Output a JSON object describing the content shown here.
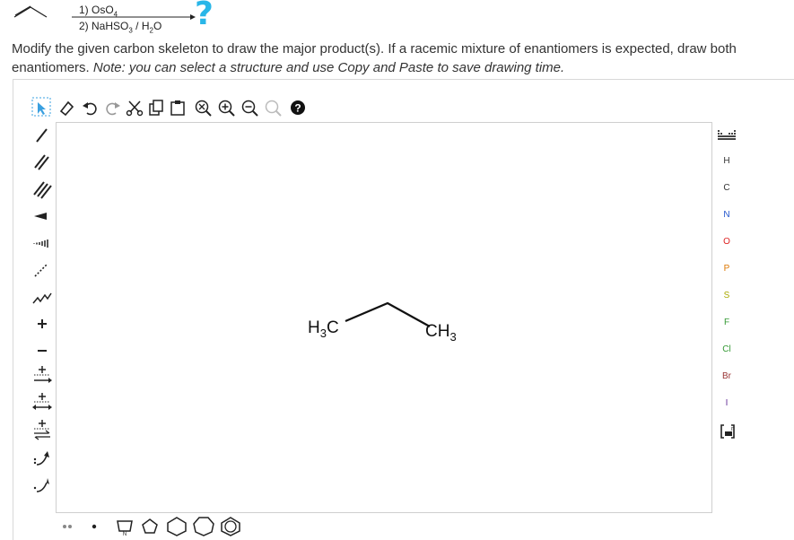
{
  "reaction": {
    "step1": "1) OsO",
    "step1_sub": "4",
    "step2_prefix": "2) NaHSO",
    "step2_sub1": "3",
    "step2_mid": " / H",
    "step2_sub2": "2",
    "step2_suffix": "O",
    "question_mark": "?"
  },
  "prompt": {
    "text": "Modify the given carbon skeleton to draw the major product(s). If a racemic mixture of enantiomers is expected, draw both enantiomers. ",
    "note": "Note: you can select a structure and use Copy and Paste to save drawing time."
  },
  "top_toolbar": [
    "select-lasso-icon",
    "eraser-icon",
    "undo-icon",
    "redo-icon",
    "cut-icon",
    "copy-icon",
    "paste-icon",
    "zoom-fit-icon",
    "zoom-in-icon",
    "zoom-out-icon",
    "zoom-reset-icon",
    "help-icon"
  ],
  "left_toolbar": [
    "single-bond-icon",
    "double-bond-icon",
    "triple-bond-icon",
    "wedge-bond-icon",
    "hash-bond-icon",
    "dashed-bond-icon",
    "chain-icon",
    "positive-charge-icon",
    "negative-charge-icon",
    "arrow-plus-icon",
    "equilibrium-arrow-icon",
    "resonance-arrow-icon",
    "curved-arrow-electron-pair-icon",
    "curved-arrow-single-electron-icon"
  ],
  "right_toolbar": {
    "periodic_icon": "periodic-table-icon",
    "elements": [
      "H",
      "C",
      "N",
      "O",
      "P",
      "S",
      "F",
      "Cl",
      "Br",
      "I"
    ],
    "element_colors": [
      "#333333",
      "#333333",
      "#2255cc",
      "#dd2222",
      "#dd7700",
      "#aaaa00",
      "#339933",
      "#339933",
      "#993333",
      "#663399"
    ],
    "bracket_icon": "bracket-icon"
  },
  "bottom_toolbar": [
    "lone-pair-icon",
    "radical-icon",
    "cyclopropane-icon",
    "cyclobutane-icon",
    "cyclopentane-icon",
    "cyclohexane-icon",
    "benzene-icon"
  ],
  "molecule": {
    "left_label": "H",
    "left_sub": "3",
    "left_suffix": "C",
    "right_prefix": "CH",
    "right_sub": "3"
  }
}
